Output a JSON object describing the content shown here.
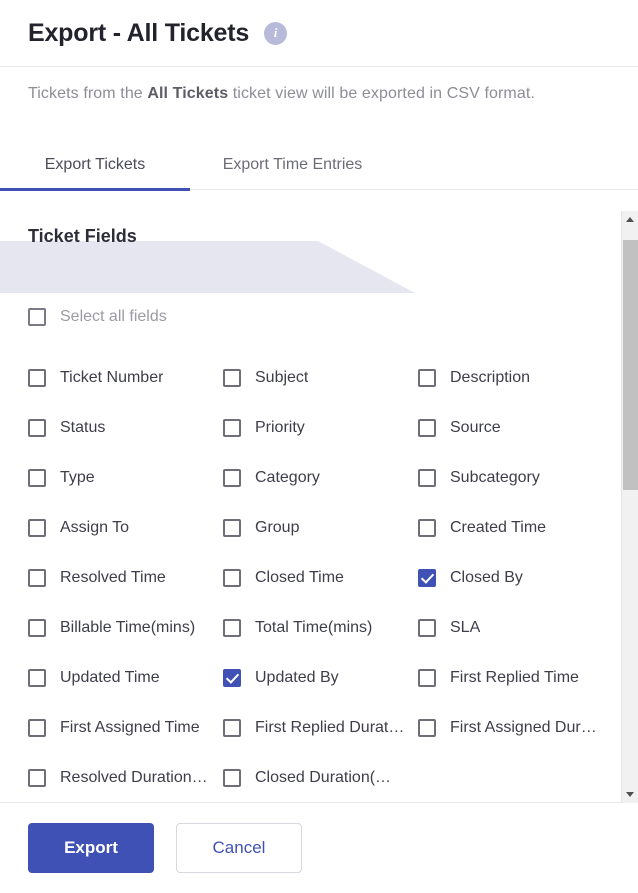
{
  "header": {
    "title": "Export - All Tickets",
    "info_icon": "info-icon",
    "info_glyph": "i"
  },
  "subtitle": {
    "prefix": "Tickets from the ",
    "view_name": "All Tickets",
    "suffix": " ticket view will be exported in CSV format."
  },
  "tabs": [
    {
      "label": "Export Tickets",
      "active": true
    },
    {
      "label": "Export Time Entries",
      "active": false
    }
  ],
  "section": {
    "banner_label": "Ticket Fields",
    "select_all_label": "Select all fields",
    "select_all_checked": false
  },
  "fields": [
    [
      {
        "label": "Ticket Number",
        "checked": false
      },
      {
        "label": "Subject",
        "checked": false
      },
      {
        "label": "Description",
        "checked": false
      }
    ],
    [
      {
        "label": "Status",
        "checked": false
      },
      {
        "label": "Priority",
        "checked": false
      },
      {
        "label": "Source",
        "checked": false
      }
    ],
    [
      {
        "label": "Type",
        "checked": false
      },
      {
        "label": "Category",
        "checked": false
      },
      {
        "label": "Subcategory",
        "checked": false
      }
    ],
    [
      {
        "label": "Assign To",
        "checked": false
      },
      {
        "label": "Group",
        "checked": false
      },
      {
        "label": "Created Time",
        "checked": false
      }
    ],
    [
      {
        "label": "Resolved Time",
        "checked": false
      },
      {
        "label": "Closed Time",
        "checked": false
      },
      {
        "label": "Closed By",
        "checked": true
      }
    ],
    [
      {
        "label": "Billable Time(mins)",
        "checked": false
      },
      {
        "label": "Total Time(mins)",
        "checked": false
      },
      {
        "label": "SLA",
        "checked": false
      }
    ],
    [
      {
        "label": "Updated Time",
        "checked": false
      },
      {
        "label": "Updated By",
        "checked": true
      },
      {
        "label": "First Replied Time",
        "checked": false
      }
    ],
    [
      {
        "label": "First Assigned Time",
        "checked": false
      },
      {
        "label": "First Replied Durat…",
        "checked": false
      },
      {
        "label": "First Assigned Dur…",
        "checked": false
      }
    ],
    [
      {
        "label": "Resolved Duration…",
        "checked": false
      },
      {
        "label": "Closed Duration(…",
        "checked": false
      },
      {
        "label": "",
        "checked": false
      }
    ]
  ],
  "scrollbar": {
    "up_arrow": "chevron-up-icon",
    "down_arrow": "chevron-down-icon"
  },
  "footer": {
    "export_label": "Export",
    "cancel_label": "Cancel"
  },
  "colors": {
    "accent": "#3f51b5",
    "banner": "#e6e6f0",
    "info_badge": "#b8bada",
    "muted_text": "#8d8d96"
  }
}
